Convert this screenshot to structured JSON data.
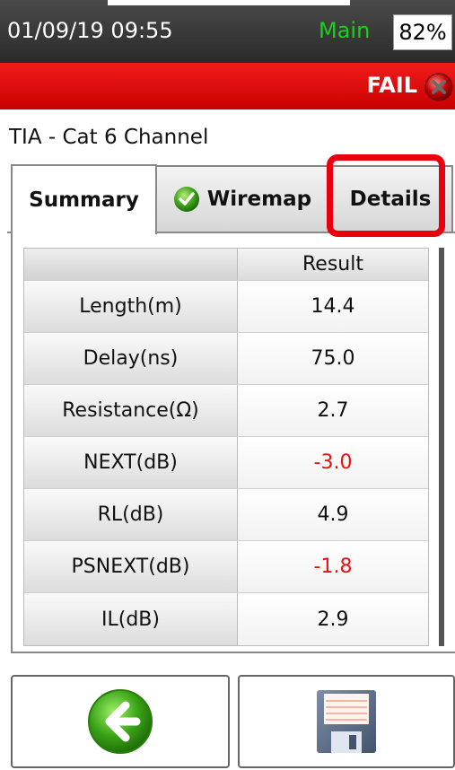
{
  "status": {
    "datetime": "01/09/19 09:55",
    "mode": "Main",
    "battery": "82%",
    "mode_color": "#19d119"
  },
  "result_banner": {
    "text": "FAIL",
    "icon": "fail-x-icon",
    "color": "#e00000"
  },
  "standard": "TIA - Cat 6 Channel",
  "tabs": [
    {
      "label": "Summary",
      "active": true
    },
    {
      "label": "Wiremap",
      "icon": "check-circle-icon",
      "active": false
    },
    {
      "label": "Details",
      "active": false,
      "highlighted": true
    }
  ],
  "table": {
    "headers": [
      "",
      "Result"
    ],
    "rows": [
      {
        "label": "Length(m)",
        "value": "14.4",
        "fail": false
      },
      {
        "label": "Delay(ns)",
        "value": "75.0",
        "fail": false
      },
      {
        "label": "Resistance(Ω)",
        "value": "2.7",
        "fail": false
      },
      {
        "label": "NEXT(dB)",
        "value": "-3.0",
        "fail": true
      },
      {
        "label": "RL(dB)",
        "value": "4.9",
        "fail": false
      },
      {
        "label": "PSNEXT(dB)",
        "value": "-1.8",
        "fail": true
      },
      {
        "label": "IL(dB)",
        "value": "2.9",
        "fail": false
      }
    ]
  },
  "buttons": {
    "back": {
      "icon": "back-arrow-icon"
    },
    "save": {
      "icon": "floppy-disk-icon"
    }
  }
}
